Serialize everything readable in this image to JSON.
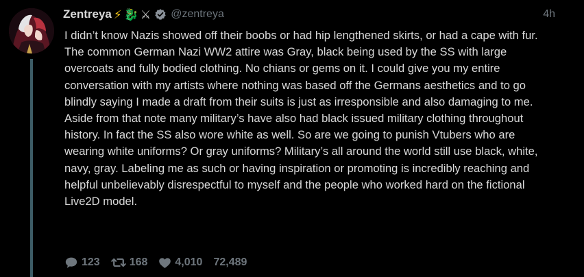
{
  "tweet": {
    "display_name": "Zentreya",
    "name_emojis": [
      "⚡",
      "🐉",
      "⚔"
    ],
    "handle": "@zentreya",
    "timestamp": "4h",
    "paragraphs": [
      "I didn’t know Nazis showed off their boobs or had hip lengthened skirts, or had a cape with fur.",
      "The common German Nazi WW2 attire was Gray, black being used by the SS with large overcoats and fully bodied clothing. No chians or gems on it. I could give you my entire conversation with my artists where nothing was based off the Germans aesthetics and to go blindly saying I made a draft from their suits is just as irresponsible and also damaging to me. Aside from that note many military’s have also had black issued military clothing throughout history. In fact the SS also wore white as well. So are we going to punish Vtubers who are wearing white uniforms? Or gray uniforms? Military’s all around the world still use black, white, navy, gray. Labeling me as such or having inspiration or promoting is incredibly reaching and helpful unbelievably disrespectful to myself and the people who worked hard on the fictional Live2D model."
    ],
    "stats": {
      "replies": "123",
      "retweets": "168",
      "likes": "4,010",
      "views": "72,489"
    }
  },
  "icons": {
    "verified": "verified-badge-icon",
    "reply": "reply-icon",
    "retweet": "retweet-icon",
    "like": "heart-icon"
  },
  "colors": {
    "background": "#000000",
    "text": "#d9d9d9",
    "muted": "#6e767d",
    "thread_line": "#3d5c66",
    "verified_badge": "#8a9199"
  }
}
